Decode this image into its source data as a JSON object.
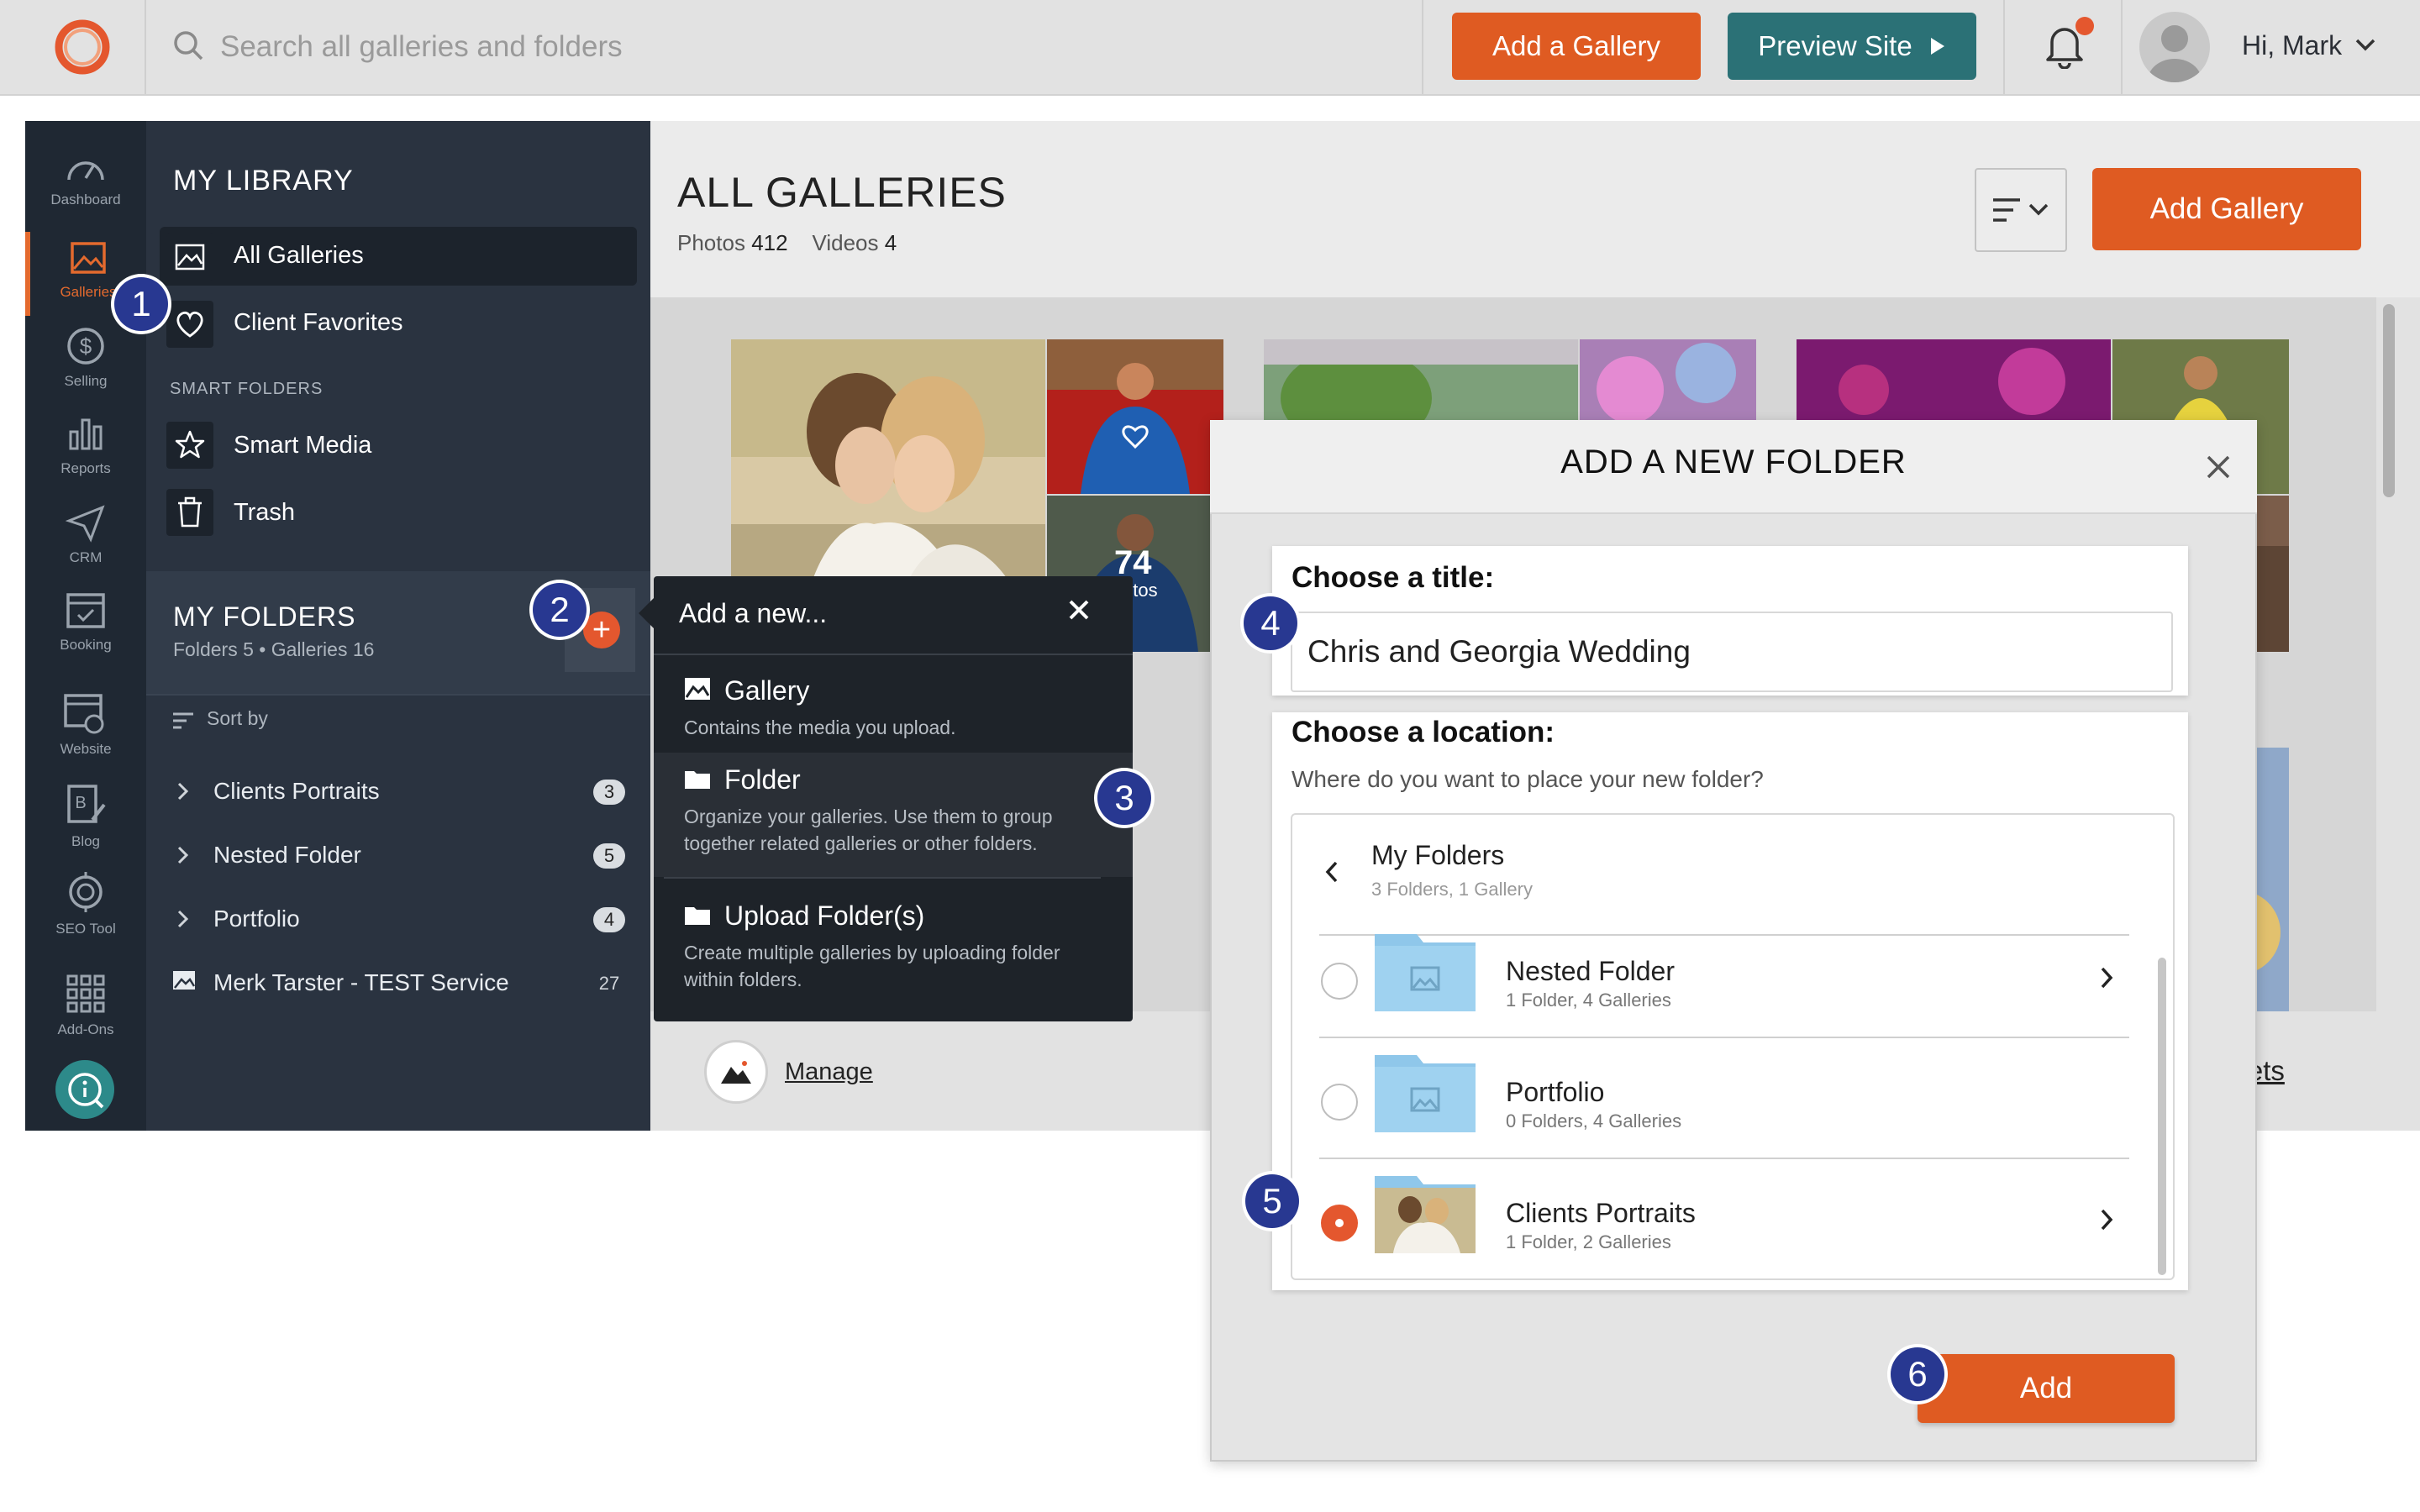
{
  "topbar": {
    "search_placeholder": "Search all galleries and folders",
    "add_gallery_label": "Add a Gallery",
    "preview_label": "Preview Site",
    "greeting": "Hi, Mark"
  },
  "nav": {
    "items": [
      {
        "label": "Dashboard",
        "icon": "speedometer-icon"
      },
      {
        "label": "Galleries",
        "icon": "image-icon"
      },
      {
        "label": "Selling",
        "icon": "dollar-icon"
      },
      {
        "label": "Reports",
        "icon": "bar-chart-icon"
      },
      {
        "label": "CRM",
        "icon": "paper-plane-icon"
      },
      {
        "label": "Booking",
        "icon": "calendar-icon"
      },
      {
        "label": "Website",
        "icon": "website-icon"
      },
      {
        "label": "Blog",
        "icon": "blog-icon"
      },
      {
        "label": "SEO Tool",
        "icon": "seo-icon"
      },
      {
        "label": "Add-Ons",
        "icon": "grid-icon"
      }
    ]
  },
  "library": {
    "title": "MY LIBRARY",
    "all_galleries": "All Galleries",
    "client_favorites": "Client Favorites",
    "smart_folders_head": "SMART FOLDERS",
    "smart_media": "Smart Media",
    "trash": "Trash"
  },
  "folders": {
    "title": "MY FOLDERS",
    "subtitle": "Folders 5 • Galleries 16",
    "sort_by": "Sort by",
    "items": [
      {
        "name": "Clients Portraits",
        "count": "3"
      },
      {
        "name": "Nested Folder",
        "count": "5"
      },
      {
        "name": "Portfolio",
        "count": "4"
      },
      {
        "name": "Merk Tarster - TEST Service",
        "count": "27"
      }
    ]
  },
  "main": {
    "title": "ALL GALLERIES",
    "photos_label": "Photos",
    "photos_count": "412",
    "videos_label": "Videos",
    "videos_count": "4",
    "add_gallery": "Add Gallery",
    "thumb_count": "74",
    "thumb_count_label": "otos",
    "manage": "Manage",
    "presets": "esets"
  },
  "popover": {
    "title": "Add a new...",
    "items": [
      {
        "title": "Gallery",
        "desc": "Contains the media you upload."
      },
      {
        "title": "Folder",
        "desc": "Organize your galleries. Use them to group together related galleries or other folders."
      },
      {
        "title": "Upload Folder(s)",
        "desc": "Create multiple galleries by uploading folder within folders."
      }
    ]
  },
  "modal": {
    "title": "ADD A NEW FOLDER",
    "choose_title": "Choose a title:",
    "title_value": "Chris and Georgia Wedding",
    "choose_location": "Choose a location:",
    "location_question": "Where do you want to place your new folder?",
    "current_folder": "My Folders",
    "current_folder_sub": "3 Folders, 1 Gallery",
    "locations": [
      {
        "name": "Nested Folder",
        "sub": "1 Folder, 4 Galleries",
        "selected": false
      },
      {
        "name": "Portfolio",
        "sub": "0 Folders, 4 Galleries",
        "selected": false
      },
      {
        "name": "Clients Portraits",
        "sub": "1 Folder, 2 Galleries",
        "selected": true
      }
    ],
    "add_label": "Add"
  },
  "steps": [
    "1",
    "2",
    "3",
    "4",
    "5",
    "6"
  ],
  "colors": {
    "accent": "#df5b22",
    "teal": "#2b7176",
    "step_marker": "#283891"
  }
}
